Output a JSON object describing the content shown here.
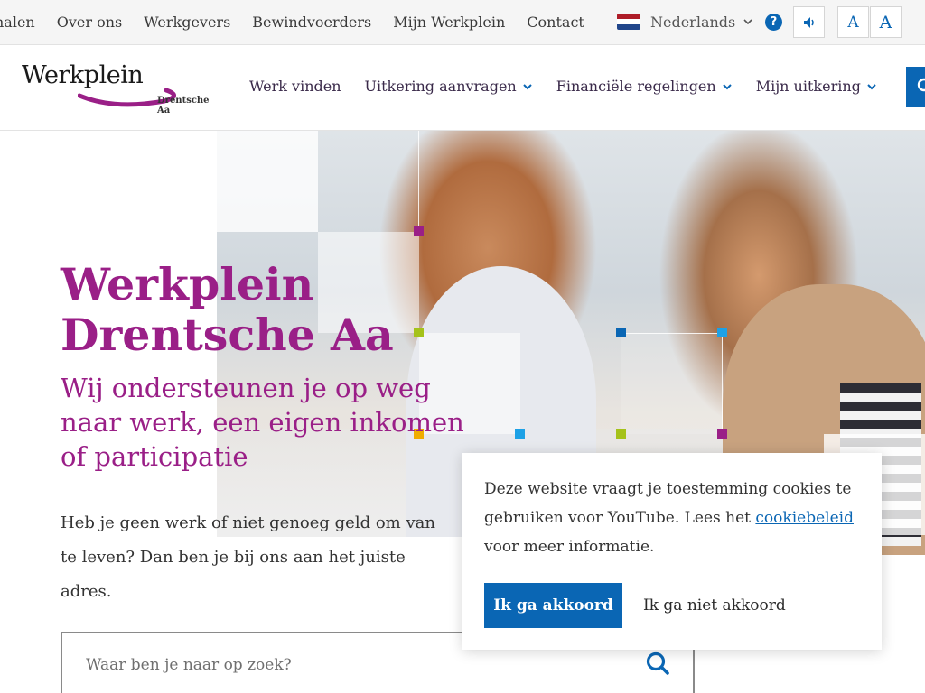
{
  "topbar": {
    "links": [
      "halen",
      "Over ons",
      "Werkgevers",
      "Bewindvoerders",
      "Mijn Werkplein",
      "Contact"
    ],
    "language": "Nederlands",
    "help_icon": "question-circle-icon",
    "readspeaker_icon": "speaker-icon",
    "font_small_label": "A",
    "font_large_label": "A"
  },
  "header": {
    "logo_main": "Werkplein",
    "logo_sub": "Drentsche Aa",
    "nav": [
      "Werk vinden",
      "Uitkering aanvragen",
      "Financiële regelingen",
      "Mijn uitkering"
    ],
    "search_icon": "search-icon"
  },
  "hero": {
    "title_line1": "Werkplein",
    "title_line2": "Drentsche Aa",
    "subtitle": "Wij ondersteunen je op weg naar werk, een eigen inkomen of participatie",
    "body": "Heb je geen werk of niet genoeg geld om van te leven? Dan ben je bij ons aan het juiste adres.",
    "search_placeholder": "Waar ben je naar op zoek?"
  },
  "cookie": {
    "text_before": "Deze website vraagt je toestemming cookies te gebruiken voor YouTube. Lees het ",
    "link": "cookiebeleid",
    "text_after": " voor meer informatie.",
    "accept": "Ik ga akkoord",
    "decline": "Ik ga niet akkoord"
  },
  "colors": {
    "brand_purple": "#9a1f87",
    "brand_blue": "#0a66b4",
    "accent_yellow": "#f0ad00",
    "accent_lime": "#a5c21a",
    "accent_cyan": "#1da1e6"
  }
}
